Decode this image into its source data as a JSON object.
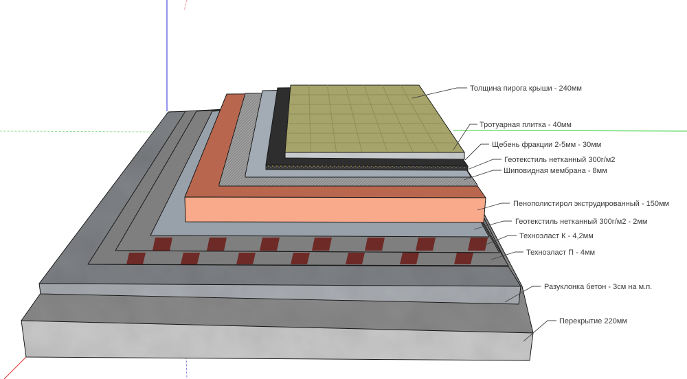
{
  "title": "Эксплуатируемая кровля — состав пирога",
  "labels": {
    "total": "Толщина пирога крыши - 240мм",
    "paver": "Тротуарная плитка - 40мм",
    "gravel": "Щебень фракции 2-5мм - 30мм",
    "geotextile_top": "Геотекстиль нетканный 300г/м2",
    "membrane": "Шиповидная мембрана - 8мм",
    "eps": "Пенополистирол экструдированный - 150мм",
    "geotextile_bottom": "Геотекстиль нетканный 300г/м2 - 2мм",
    "technoelast_k": "Техноэласт К - 4,2мм",
    "technoelast_p": "Техноэласт П - 4мм",
    "screed": "Разуклонка бетон - 3см на м.п.",
    "slab": "Перекрытие 220мм"
  },
  "colors": {
    "paver": "#a6a46a",
    "gravel": "#3a3a3a",
    "geotextile": "#a3acb5",
    "membrane": "#8c8c8c",
    "eps_front": "#f8aa8a",
    "eps_top": "#b9664f",
    "technoelast": "#7d7d7d",
    "stripe": "#6e2a26",
    "concrete": "#a9adb2",
    "slab": "#c9c9c9"
  }
}
